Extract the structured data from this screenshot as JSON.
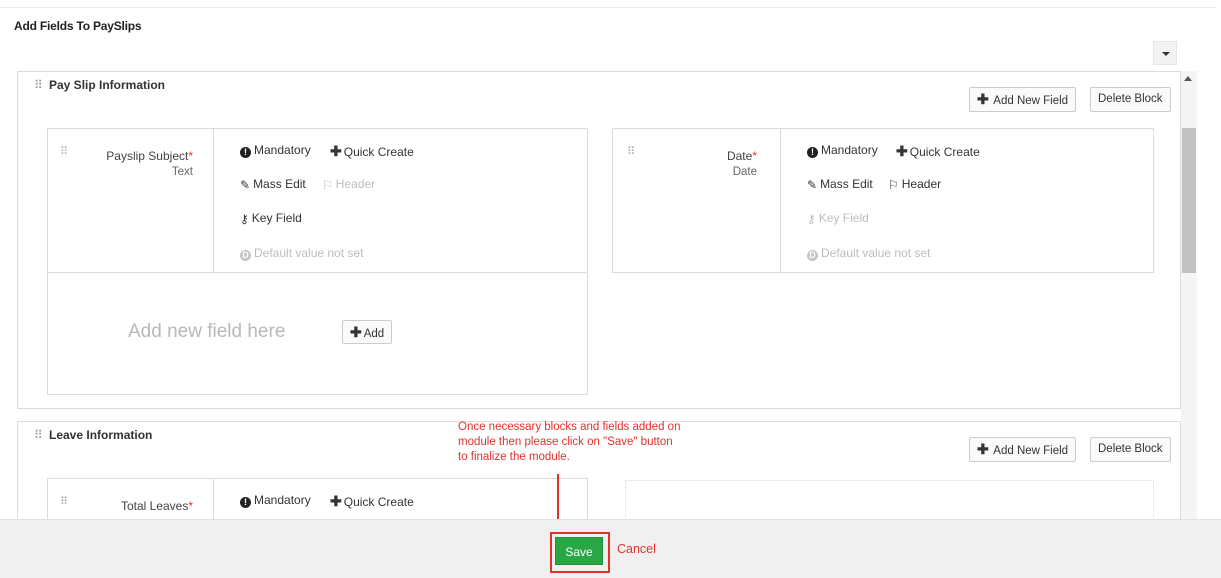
{
  "page": {
    "title": "Add Fields To PaySlips"
  },
  "blocks": [
    {
      "title": "Pay Slip Information",
      "add_field_label": "Add New Field",
      "delete_label": "Delete Block",
      "fields": [
        {
          "name": "Payslip Subject",
          "required_mark": "*",
          "type": "Text",
          "options": {
            "mandatory": "Mandatory",
            "quick_create": "Quick Create",
            "mass_edit": "Mass Edit",
            "header": "Header",
            "key_field": "Key Field",
            "default_value": "Default value not set"
          }
        },
        {
          "name": "Date",
          "required_mark": "*",
          "type": "Date",
          "options": {
            "mandatory": "Mandatory",
            "quick_create": "Quick Create",
            "mass_edit": "Mass Edit",
            "header": "Header",
            "key_field": "Key Field",
            "default_value": "Default value not set"
          }
        }
      ],
      "add_new_field_here": "Add new field here",
      "add_button_label": "Add"
    },
    {
      "title": "Leave Information",
      "add_field_label": "Add New Field",
      "delete_label": "Delete Block",
      "fields": [
        {
          "name": "Total Leaves",
          "required_mark": "*",
          "options": {
            "mandatory": "Mandatory",
            "quick_create": "Quick Create"
          }
        }
      ]
    }
  ],
  "annotation": {
    "lines": [
      "Once necessary blocks and fields added on",
      "module then please click on \"Save\" button",
      "to finalize the module."
    ],
    "color": "#e0322b"
  },
  "footer": {
    "save_label": "Save",
    "cancel_label": "Cancel",
    "save_color": "#2aa745"
  }
}
